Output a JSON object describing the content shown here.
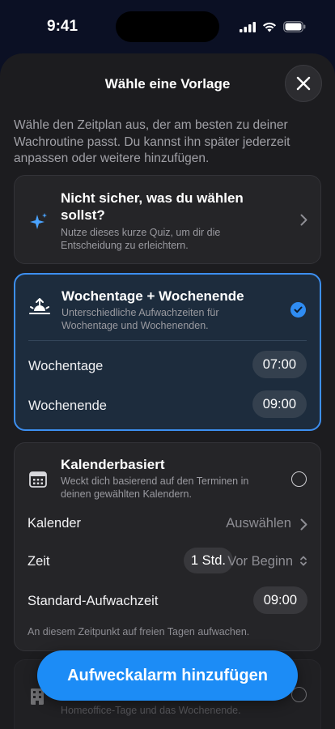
{
  "status": {
    "time": "9:41"
  },
  "sheet": {
    "title": "Wähle eine Vorlage",
    "intro": "Wähle den Zeitplan aus, der am besten zu deiner Wachroutine passt. Du kannst ihn später jederzeit anpassen oder weitere hinzufügen."
  },
  "quiz": {
    "title": "Nicht sicher, was du wählen sollst?",
    "subtitle": "Nutze dieses kurze Quiz, um dir die Entscheidung zu erleichtern."
  },
  "weekday_weekend": {
    "title": "Wochentage + Wochenende",
    "subtitle": "Unterschiedliche Aufwachzeiten für Wochentage und Wochenenden.",
    "selected": true,
    "rows": [
      {
        "label": "Wochentage",
        "time": "07:00"
      },
      {
        "label": "Wochenende",
        "time": "09:00"
      }
    ]
  },
  "calendar": {
    "title": "Kalenderbasiert",
    "subtitle": "Weckt dich basierend auf den Terminen in deinen gewählten Kalendern.",
    "calendar_label": "Kalender",
    "calendar_value": "Auswählen",
    "time_label": "Zeit",
    "time_offset": "1 Std.",
    "time_relation": "Vor Beginn",
    "default_label": "Standard-Aufwachzeit",
    "default_time": "09:00",
    "note": "An diesem Zeitpunkt auf freien Tagen aufwachen."
  },
  "office": {
    "subtitle_partial": "Homeoffice-Tage und das Wochenende."
  },
  "cta": {
    "label": "Aufweckalarm hinzufügen"
  },
  "colors": {
    "accent": "#1c8cf6",
    "selected_border": "#3d8ff0"
  }
}
